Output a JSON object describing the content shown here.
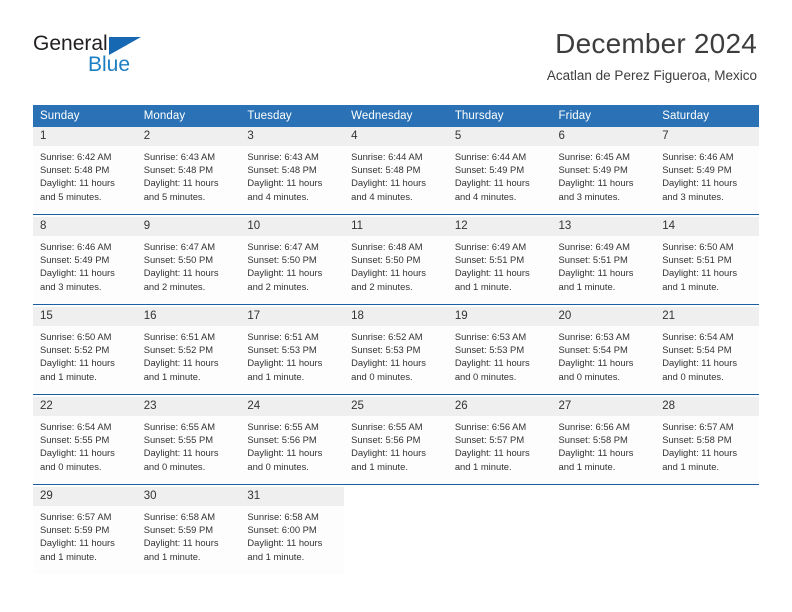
{
  "logo": {
    "word1": "General",
    "word2": "Blue",
    "triangle_icon": "blue-triangle-icon",
    "blue": "#1d7fc3",
    "dark": "#231f20"
  },
  "header": {
    "title": "December 2024",
    "subtitle": "Acatlan de Perez Figueroa, Mexico"
  },
  "theme": {
    "header_bg": "#2a72b5",
    "header_text": "#ffffff",
    "daynum_bg": "#efefef",
    "cell_bg": "#fdfdfd",
    "separator": "#1b5fa0",
    "body_text": "#333333"
  },
  "weekdays": [
    "Sunday",
    "Monday",
    "Tuesday",
    "Wednesday",
    "Thursday",
    "Friday",
    "Saturday"
  ],
  "weeks": [
    [
      {
        "day": "1",
        "sunrise": "Sunrise: 6:42 AM",
        "sunset": "Sunset: 5:48 PM",
        "daylight1": "Daylight: 11 hours",
        "daylight2": "and 5 minutes."
      },
      {
        "day": "2",
        "sunrise": "Sunrise: 6:43 AM",
        "sunset": "Sunset: 5:48 PM",
        "daylight1": "Daylight: 11 hours",
        "daylight2": "and 5 minutes."
      },
      {
        "day": "3",
        "sunrise": "Sunrise: 6:43 AM",
        "sunset": "Sunset: 5:48 PM",
        "daylight1": "Daylight: 11 hours",
        "daylight2": "and 4 minutes."
      },
      {
        "day": "4",
        "sunrise": "Sunrise: 6:44 AM",
        "sunset": "Sunset: 5:48 PM",
        "daylight1": "Daylight: 11 hours",
        "daylight2": "and 4 minutes."
      },
      {
        "day": "5",
        "sunrise": "Sunrise: 6:44 AM",
        "sunset": "Sunset: 5:49 PM",
        "daylight1": "Daylight: 11 hours",
        "daylight2": "and 4 minutes."
      },
      {
        "day": "6",
        "sunrise": "Sunrise: 6:45 AM",
        "sunset": "Sunset: 5:49 PM",
        "daylight1": "Daylight: 11 hours",
        "daylight2": "and 3 minutes."
      },
      {
        "day": "7",
        "sunrise": "Sunrise: 6:46 AM",
        "sunset": "Sunset: 5:49 PM",
        "daylight1": "Daylight: 11 hours",
        "daylight2": "and 3 minutes."
      }
    ],
    [
      {
        "day": "8",
        "sunrise": "Sunrise: 6:46 AM",
        "sunset": "Sunset: 5:49 PM",
        "daylight1": "Daylight: 11 hours",
        "daylight2": "and 3 minutes."
      },
      {
        "day": "9",
        "sunrise": "Sunrise: 6:47 AM",
        "sunset": "Sunset: 5:50 PM",
        "daylight1": "Daylight: 11 hours",
        "daylight2": "and 2 minutes."
      },
      {
        "day": "10",
        "sunrise": "Sunrise: 6:47 AM",
        "sunset": "Sunset: 5:50 PM",
        "daylight1": "Daylight: 11 hours",
        "daylight2": "and 2 minutes."
      },
      {
        "day": "11",
        "sunrise": "Sunrise: 6:48 AM",
        "sunset": "Sunset: 5:50 PM",
        "daylight1": "Daylight: 11 hours",
        "daylight2": "and 2 minutes."
      },
      {
        "day": "12",
        "sunrise": "Sunrise: 6:49 AM",
        "sunset": "Sunset: 5:51 PM",
        "daylight1": "Daylight: 11 hours",
        "daylight2": "and 1 minute."
      },
      {
        "day": "13",
        "sunrise": "Sunrise: 6:49 AM",
        "sunset": "Sunset: 5:51 PM",
        "daylight1": "Daylight: 11 hours",
        "daylight2": "and 1 minute."
      },
      {
        "day": "14",
        "sunrise": "Sunrise: 6:50 AM",
        "sunset": "Sunset: 5:51 PM",
        "daylight1": "Daylight: 11 hours",
        "daylight2": "and 1 minute."
      }
    ],
    [
      {
        "day": "15",
        "sunrise": "Sunrise: 6:50 AM",
        "sunset": "Sunset: 5:52 PM",
        "daylight1": "Daylight: 11 hours",
        "daylight2": "and 1 minute."
      },
      {
        "day": "16",
        "sunrise": "Sunrise: 6:51 AM",
        "sunset": "Sunset: 5:52 PM",
        "daylight1": "Daylight: 11 hours",
        "daylight2": "and 1 minute."
      },
      {
        "day": "17",
        "sunrise": "Sunrise: 6:51 AM",
        "sunset": "Sunset: 5:53 PM",
        "daylight1": "Daylight: 11 hours",
        "daylight2": "and 1 minute."
      },
      {
        "day": "18",
        "sunrise": "Sunrise: 6:52 AM",
        "sunset": "Sunset: 5:53 PM",
        "daylight1": "Daylight: 11 hours",
        "daylight2": "and 0 minutes."
      },
      {
        "day": "19",
        "sunrise": "Sunrise: 6:53 AM",
        "sunset": "Sunset: 5:53 PM",
        "daylight1": "Daylight: 11 hours",
        "daylight2": "and 0 minutes."
      },
      {
        "day": "20",
        "sunrise": "Sunrise: 6:53 AM",
        "sunset": "Sunset: 5:54 PM",
        "daylight1": "Daylight: 11 hours",
        "daylight2": "and 0 minutes."
      },
      {
        "day": "21",
        "sunrise": "Sunrise: 6:54 AM",
        "sunset": "Sunset: 5:54 PM",
        "daylight1": "Daylight: 11 hours",
        "daylight2": "and 0 minutes."
      }
    ],
    [
      {
        "day": "22",
        "sunrise": "Sunrise: 6:54 AM",
        "sunset": "Sunset: 5:55 PM",
        "daylight1": "Daylight: 11 hours",
        "daylight2": "and 0 minutes."
      },
      {
        "day": "23",
        "sunrise": "Sunrise: 6:55 AM",
        "sunset": "Sunset: 5:55 PM",
        "daylight1": "Daylight: 11 hours",
        "daylight2": "and 0 minutes."
      },
      {
        "day": "24",
        "sunrise": "Sunrise: 6:55 AM",
        "sunset": "Sunset: 5:56 PM",
        "daylight1": "Daylight: 11 hours",
        "daylight2": "and 0 minutes."
      },
      {
        "day": "25",
        "sunrise": "Sunrise: 6:55 AM",
        "sunset": "Sunset: 5:56 PM",
        "daylight1": "Daylight: 11 hours",
        "daylight2": "and 1 minute."
      },
      {
        "day": "26",
        "sunrise": "Sunrise: 6:56 AM",
        "sunset": "Sunset: 5:57 PM",
        "daylight1": "Daylight: 11 hours",
        "daylight2": "and 1 minute."
      },
      {
        "day": "27",
        "sunrise": "Sunrise: 6:56 AM",
        "sunset": "Sunset: 5:58 PM",
        "daylight1": "Daylight: 11 hours",
        "daylight2": "and 1 minute."
      },
      {
        "day": "28",
        "sunrise": "Sunrise: 6:57 AM",
        "sunset": "Sunset: 5:58 PM",
        "daylight1": "Daylight: 11 hours",
        "daylight2": "and 1 minute."
      }
    ],
    [
      {
        "day": "29",
        "sunrise": "Sunrise: 6:57 AM",
        "sunset": "Sunset: 5:59 PM",
        "daylight1": "Daylight: 11 hours",
        "daylight2": "and 1 minute."
      },
      {
        "day": "30",
        "sunrise": "Sunrise: 6:58 AM",
        "sunset": "Sunset: 5:59 PM",
        "daylight1": "Daylight: 11 hours",
        "daylight2": "and 1 minute."
      },
      {
        "day": "31",
        "sunrise": "Sunrise: 6:58 AM",
        "sunset": "Sunset: 6:00 PM",
        "daylight1": "Daylight: 11 hours",
        "daylight2": "and 1 minute."
      },
      {
        "day": "",
        "sunrise": "",
        "sunset": "",
        "daylight1": "",
        "daylight2": ""
      },
      {
        "day": "",
        "sunrise": "",
        "sunset": "",
        "daylight1": "",
        "daylight2": ""
      },
      {
        "day": "",
        "sunrise": "",
        "sunset": "",
        "daylight1": "",
        "daylight2": ""
      },
      {
        "day": "",
        "sunrise": "",
        "sunset": "",
        "daylight1": "",
        "daylight2": ""
      }
    ]
  ]
}
